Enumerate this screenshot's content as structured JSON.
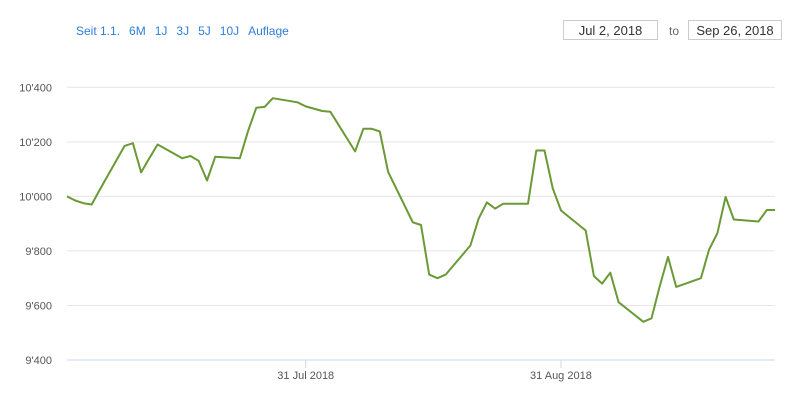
{
  "range_selector": {
    "buttons": [
      "Seit 1.1.",
      "6M",
      "1J",
      "3J",
      "5J",
      "10J",
      "Auflage"
    ]
  },
  "date_inputs": {
    "from": "Jul 2, 2018",
    "to_label": "to",
    "to": "Sep 26, 2018"
  },
  "colors": {
    "line": "#6a9a35",
    "grid": "#e6e6e6",
    "axis": "#ccd6eb",
    "accent": "#2f7ed8"
  },
  "chart_data": {
    "type": "line",
    "title": "",
    "xlabel": "",
    "ylabel": "",
    "ylim": [
      9400,
      10500
    ],
    "xlim": [
      "2018-07-02",
      "2018-09-26"
    ],
    "yticks": [
      {
        "value": 9400,
        "label": "9'400"
      },
      {
        "value": 9600,
        "label": "9'600"
      },
      {
        "value": 9800,
        "label": "9'800"
      },
      {
        "value": 10000,
        "label": "10'000"
      },
      {
        "value": 10200,
        "label": "10'200"
      },
      {
        "value": 10400,
        "label": "10'400"
      }
    ],
    "xticks": [
      {
        "date": "2018-07-31",
        "label": "31 Jul 2018"
      },
      {
        "date": "2018-08-31",
        "label": "31 Aug 2018"
      }
    ],
    "grid": true,
    "legend": "none",
    "series": [
      {
        "x": [
          "2018-07-02",
          "2018-07-03",
          "2018-07-04",
          "2018-07-05",
          "2018-07-06",
          "2018-07-09",
          "2018-07-10",
          "2018-07-11",
          "2018-07-12",
          "2018-07-13",
          "2018-07-16",
          "2018-07-17",
          "2018-07-18",
          "2018-07-19",
          "2018-07-20",
          "2018-07-23",
          "2018-07-24",
          "2018-07-25",
          "2018-07-26",
          "2018-07-27",
          "2018-07-30",
          "2018-07-31",
          "2018-08-02",
          "2018-08-03",
          "2018-08-06",
          "2018-08-07",
          "2018-08-08",
          "2018-08-09",
          "2018-08-10",
          "2018-08-13",
          "2018-08-14",
          "2018-08-15",
          "2018-08-16",
          "2018-08-17",
          "2018-08-20",
          "2018-08-21",
          "2018-08-22",
          "2018-08-23",
          "2018-08-24",
          "2018-08-27",
          "2018-08-28",
          "2018-08-29",
          "2018-08-30",
          "2018-08-31",
          "2018-09-03",
          "2018-09-04",
          "2018-09-05",
          "2018-09-06",
          "2018-09-07",
          "2018-09-10",
          "2018-09-11",
          "2018-09-12",
          "2018-09-13",
          "2018-09-14",
          "2018-09-17",
          "2018-09-18",
          "2018-09-19",
          "2018-09-20",
          "2018-09-21",
          "2018-09-24",
          "2018-09-25",
          "2018-09-26"
        ],
        "values": [
          10000,
          9985,
          9975,
          9970,
          10025,
          10185,
          10195,
          10088,
          10140,
          10190,
          10140,
          10148,
          10130,
          10058,
          10145,
          10140,
          10240,
          10325,
          10328,
          10360,
          10345,
          10330,
          10313,
          10310,
          10165,
          10248,
          10248,
          10238,
          10090,
          9905,
          9895,
          9713,
          9700,
          9713,
          9820,
          9918,
          9978,
          9955,
          9973,
          9973,
          10168,
          10168,
          10030,
          9948,
          9875,
          9708,
          9680,
          9720,
          9612,
          9540,
          9553,
          9670,
          9778,
          9668,
          9700,
          9805,
          9865,
          9998,
          9915,
          9908,
          9950,
          9950
        ]
      }
    ]
  }
}
